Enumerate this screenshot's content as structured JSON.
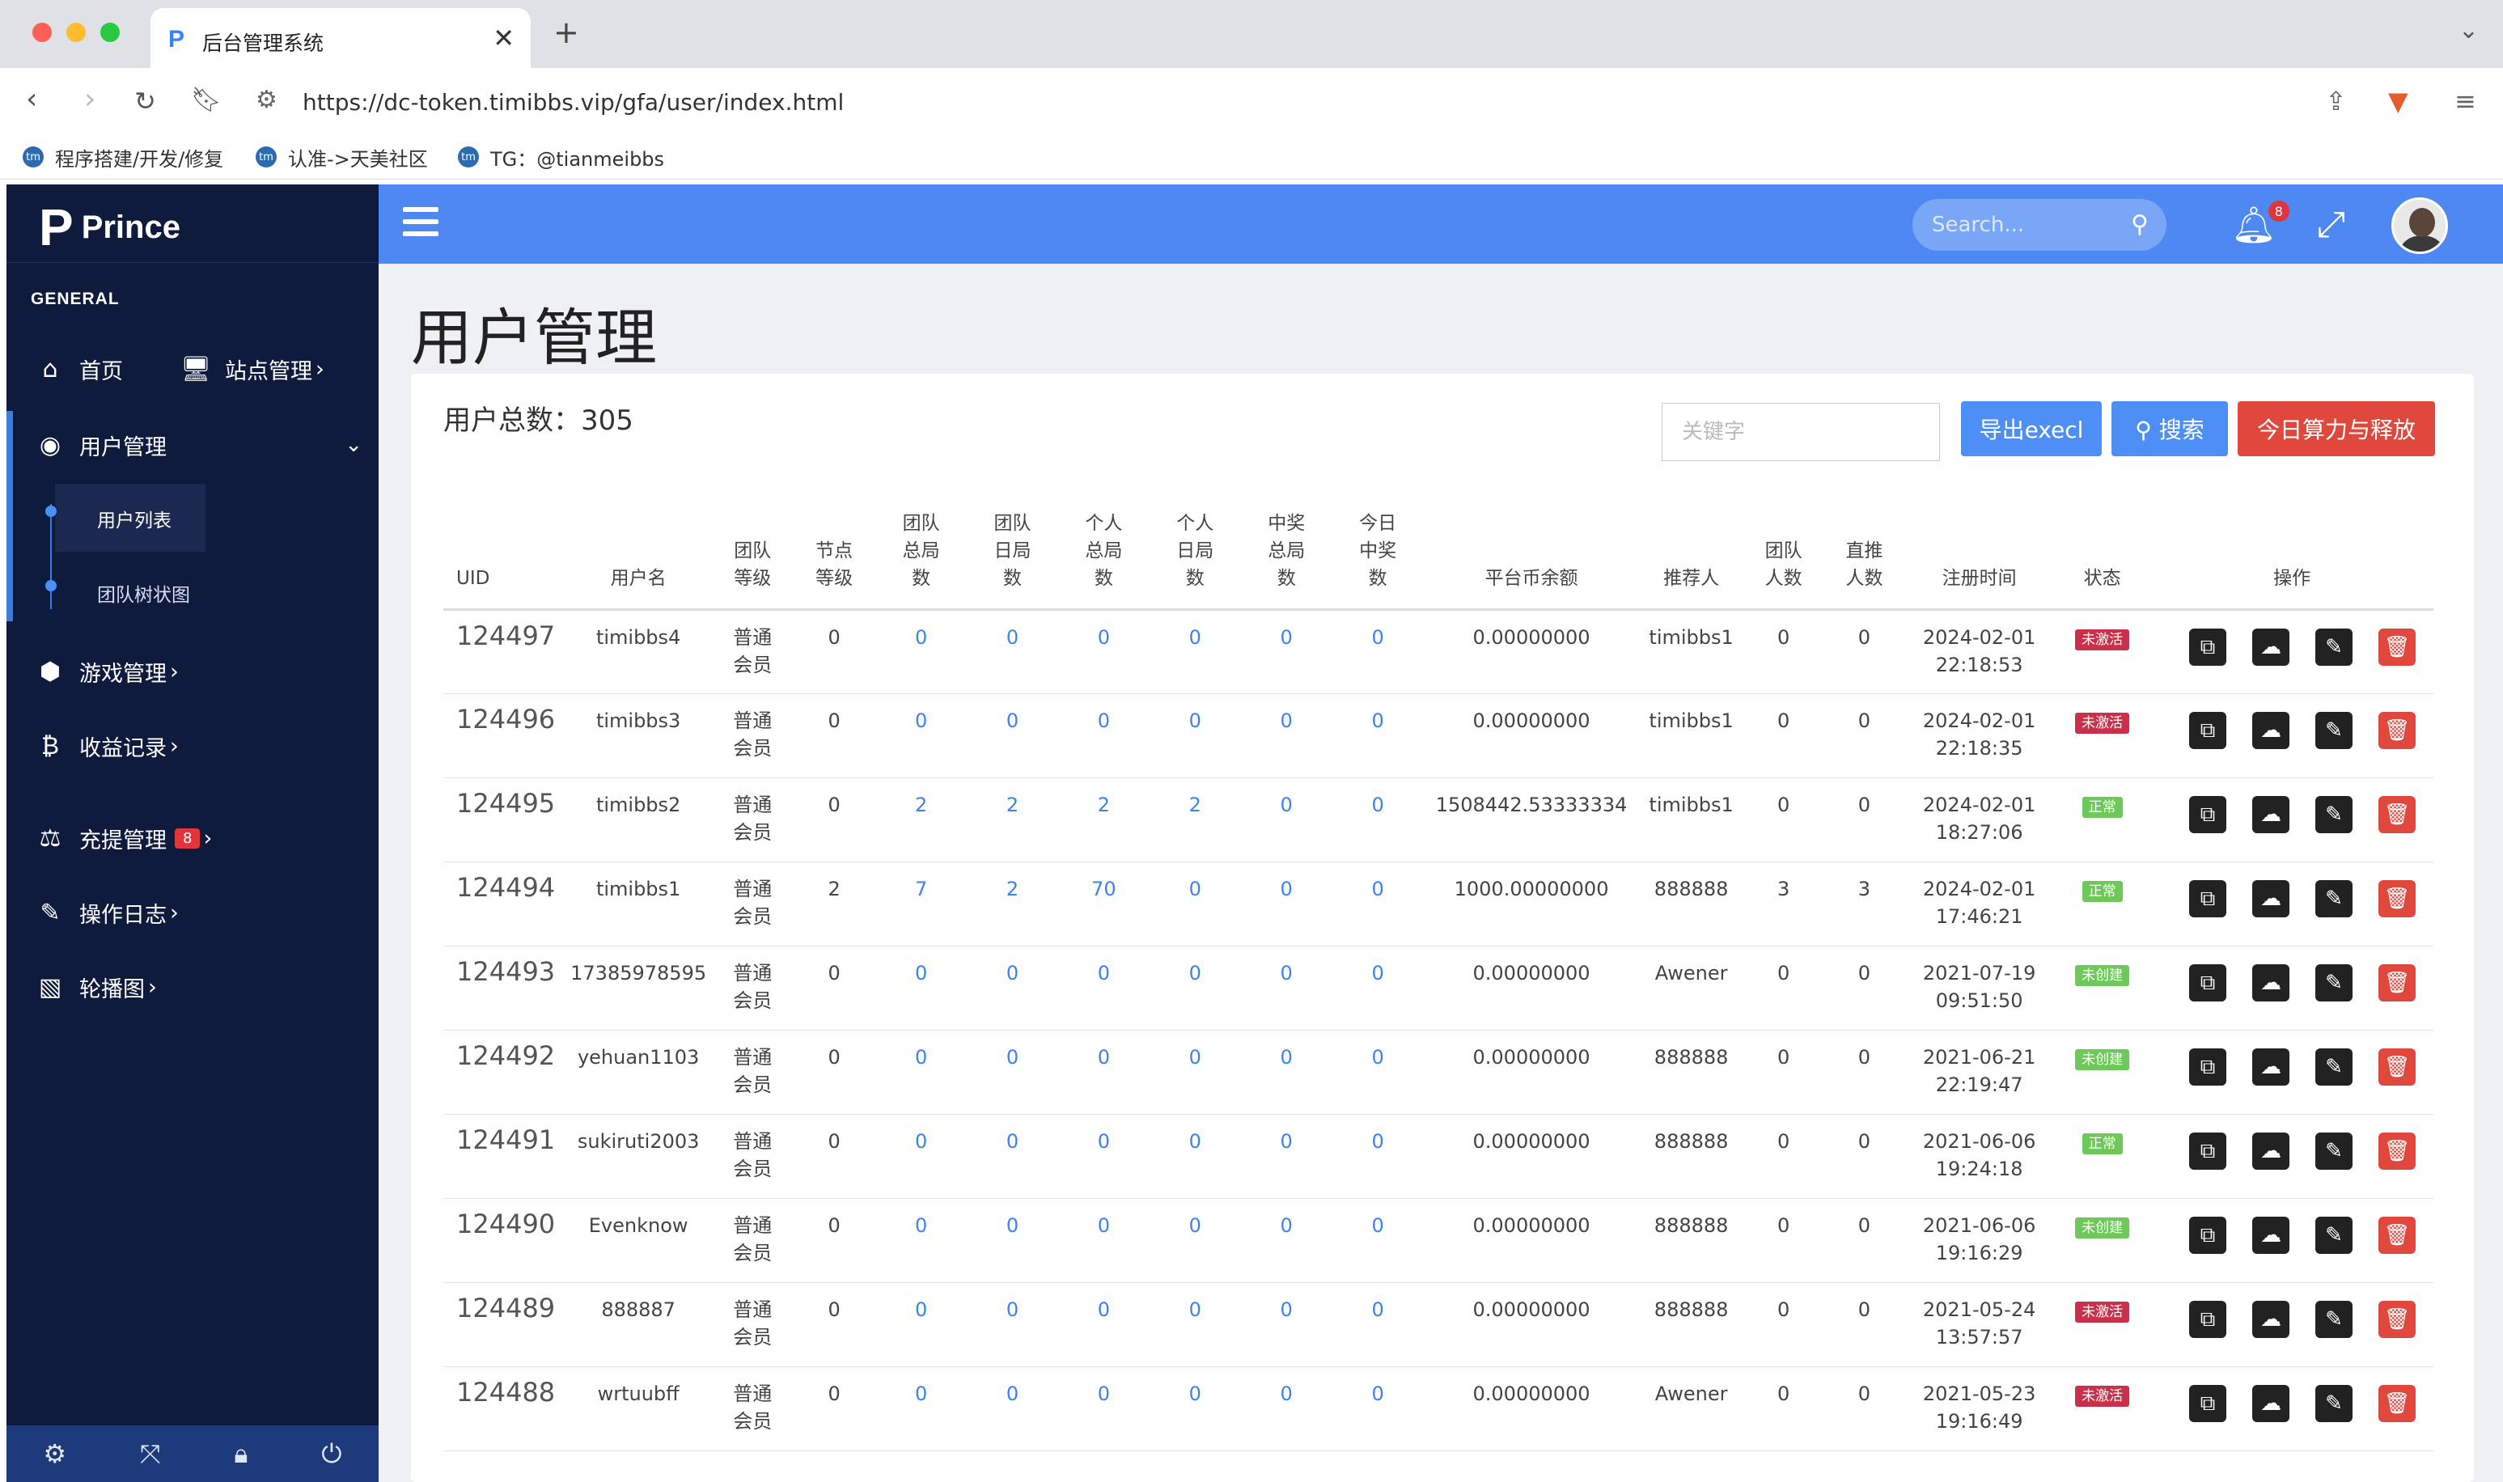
{
  "browser": {
    "tab_title": "后台管理系统",
    "url": "https://dc-token.timibbs.vip/gfa/user/index.html",
    "bookmarks": [
      "程序搭建/开发/修复",
      "认准->天美社区",
      "TG：@tianmeibbs"
    ]
  },
  "sidebar": {
    "brand": "Prince",
    "section": "GENERAL",
    "home": "首页",
    "site": "站点管理",
    "user_mgmt": "用户管理",
    "user_list": "用户列表",
    "team_tree": "团队树状图",
    "game": "游戏管理",
    "income": "收益记录",
    "recharge": "充提管理",
    "recharge_badge": "8",
    "oplog": "操作日志",
    "carousel": "轮播图"
  },
  "header": {
    "search_placeholder": "Search...",
    "notif_count": "8"
  },
  "page": {
    "title": "用户管理",
    "total": "用户总数：305",
    "keyword_placeholder": "关键字",
    "export_btn": "导出execl",
    "search_btn": "搜索",
    "release_btn": "今日算力与释放"
  },
  "table": {
    "columns": [
      "UID",
      "用户名",
      "团队等级",
      "节点等级",
      "团队总局数",
      "团队日局数",
      "个人总局数",
      "个人日局数",
      "中奖总局数",
      "今日中奖数",
      "平台币余额",
      "推荐人",
      "团队人数",
      "直推人数",
      "注册时间",
      "状态",
      "操作"
    ],
    "rows": [
      {
        "uid": "124497",
        "name": "timibbs4",
        "level": "普通会员",
        "node": "0",
        "t_total": "0",
        "t_day": "0",
        "p_total": "0",
        "p_day": "0",
        "w_total": "0",
        "w_today": "0",
        "balance": "0.00000000",
        "ref": "timibbs1",
        "team": "0",
        "direct": "0",
        "reg": "2024-02-01 22:18:53",
        "status": "未激活",
        "status_type": "red"
      },
      {
        "uid": "124496",
        "name": "timibbs3",
        "level": "普通会员",
        "node": "0",
        "t_total": "0",
        "t_day": "0",
        "p_total": "0",
        "p_day": "0",
        "w_total": "0",
        "w_today": "0",
        "balance": "0.00000000",
        "ref": "timibbs1",
        "team": "0",
        "direct": "0",
        "reg": "2024-02-01 22:18:35",
        "status": "未激活",
        "status_type": "red"
      },
      {
        "uid": "124495",
        "name": "timibbs2",
        "level": "普通会员",
        "node": "0",
        "t_total": "2",
        "t_day": "2",
        "p_total": "2",
        "p_day": "2",
        "w_total": "0",
        "w_today": "0",
        "balance": "1508442.53333334",
        "ref": "timibbs1",
        "team": "0",
        "direct": "0",
        "reg": "2024-02-01 18:27:06",
        "status": "正常",
        "status_type": "green"
      },
      {
        "uid": "124494",
        "name": "timibbs1",
        "level": "普通会员",
        "node": "2",
        "t_total": "7",
        "t_day": "2",
        "p_total": "70",
        "p_day": "0",
        "w_total": "0",
        "w_today": "0",
        "balance": "1000.00000000",
        "ref": "888888",
        "team": "3",
        "direct": "3",
        "reg": "2024-02-01 17:46:21",
        "status": "正常",
        "status_type": "green"
      },
      {
        "uid": "124493",
        "name": "17385978595",
        "level": "普通会员",
        "node": "0",
        "t_total": "0",
        "t_day": "0",
        "p_total": "0",
        "p_day": "0",
        "w_total": "0",
        "w_today": "0",
        "balance": "0.00000000",
        "ref": "Awener",
        "team": "0",
        "direct": "0",
        "reg": "2021-07-19 09:51:50",
        "status": "未创建",
        "status_type": "green"
      },
      {
        "uid": "124492",
        "name": "yehuan1103",
        "level": "普通会员",
        "node": "0",
        "t_total": "0",
        "t_day": "0",
        "p_total": "0",
        "p_day": "0",
        "w_total": "0",
        "w_today": "0",
        "balance": "0.00000000",
        "ref": "888888",
        "team": "0",
        "direct": "0",
        "reg": "2021-06-21 22:19:47",
        "status": "未创建",
        "status_type": "green"
      },
      {
        "uid": "124491",
        "name": "sukiruti2003",
        "level": "普通会员",
        "node": "0",
        "t_total": "0",
        "t_day": "0",
        "p_total": "0",
        "p_day": "0",
        "w_total": "0",
        "w_today": "0",
        "balance": "0.00000000",
        "ref": "888888",
        "team": "0",
        "direct": "0",
        "reg": "2021-06-06 19:24:18",
        "status": "正常",
        "status_type": "green"
      },
      {
        "uid": "124490",
        "name": "Evenknow",
        "level": "普通会员",
        "node": "0",
        "t_total": "0",
        "t_day": "0",
        "p_total": "0",
        "p_day": "0",
        "w_total": "0",
        "w_today": "0",
        "balance": "0.00000000",
        "ref": "888888",
        "team": "0",
        "direct": "0",
        "reg": "2021-06-06 19:16:29",
        "status": "未创建",
        "status_type": "green"
      },
      {
        "uid": "124489",
        "name": "888887",
        "level": "普通会员",
        "node": "0",
        "t_total": "0",
        "t_day": "0",
        "p_total": "0",
        "p_day": "0",
        "w_total": "0",
        "w_today": "0",
        "balance": "0.00000000",
        "ref": "888888",
        "team": "0",
        "direct": "0",
        "reg": "2021-05-24 13:57:57",
        "status": "未激活",
        "status_type": "red"
      },
      {
        "uid": "124488",
        "name": "wrtuubff",
        "level": "普通会员",
        "node": "0",
        "t_total": "0",
        "t_day": "0",
        "p_total": "0",
        "p_day": "0",
        "w_total": "0",
        "w_today": "0",
        "balance": "0.00000000",
        "ref": "Awener",
        "team": "0",
        "direct": "0",
        "reg": "2021-05-23 19:16:49",
        "status": "未激活",
        "status_type": "red"
      }
    ]
  }
}
